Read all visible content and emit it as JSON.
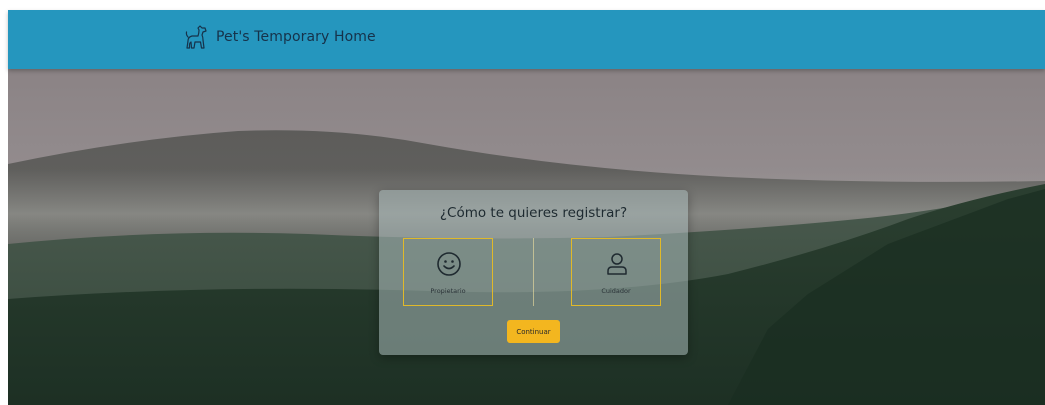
{
  "navbar": {
    "brand_text": "Pet's Temporary Home",
    "brand_icon": "dog-icon",
    "color": "#2596be"
  },
  "dialog": {
    "title": "¿Cómo te quieres registrar?",
    "options": [
      {
        "label": "Propietario",
        "icon": "smiley-face-icon"
      },
      {
        "label": "Cuidador",
        "icon": "user-icon"
      }
    ],
    "option_border_color": "#e0b92a",
    "continue_label": "Continuar",
    "continue_color": "#f3b61f"
  },
  "background": {
    "description_icon": "forest-mountain-background"
  }
}
